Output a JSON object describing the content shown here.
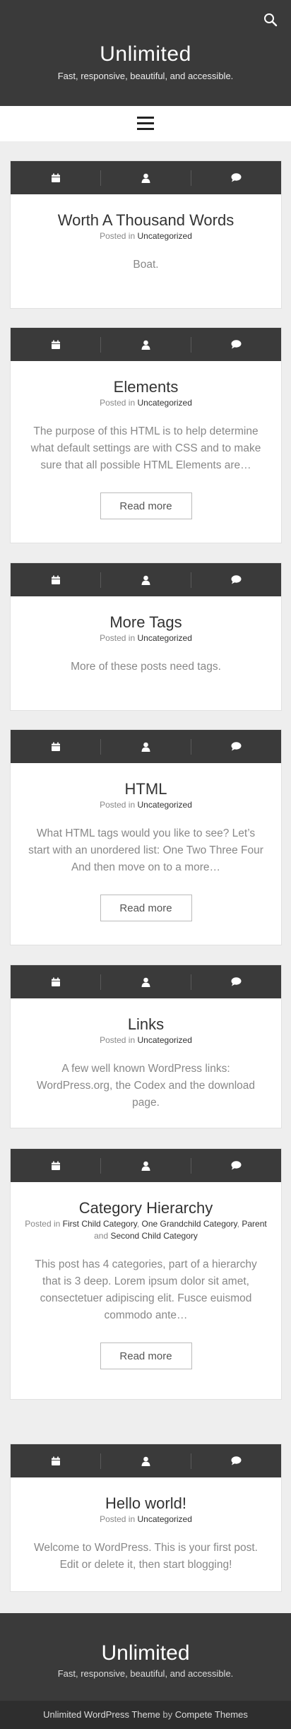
{
  "header": {
    "title": "Unlimited",
    "tagline": "Fast, responsive, beautiful, and accessible."
  },
  "posts": [
    {
      "title": "Worth A Thousand Words",
      "posted_in": "Posted in",
      "categories": [
        "Uncategorized"
      ],
      "excerpt": "Boat.",
      "read_more": ""
    },
    {
      "title": "Elements",
      "posted_in": "Posted in",
      "categories": [
        "Uncategorized"
      ],
      "excerpt": "The purpose of this HTML is to help determine what default settings are with CSS and to make sure that all possible HTML Elements are…",
      "read_more": "Read more"
    },
    {
      "title": "More Tags",
      "posted_in": "Posted in",
      "categories": [
        "Uncategorized"
      ],
      "excerpt": "More of these posts need tags.",
      "read_more": ""
    },
    {
      "title": "HTML",
      "posted_in": "Posted in",
      "categories": [
        "Uncategorized"
      ],
      "excerpt": "What HTML tags would you like to see? Let’s start with an unordered list: One Two Three Four And then move on to a more…",
      "read_more": "Read more"
    },
    {
      "title": "Links",
      "posted_in": "Posted in",
      "categories": [
        "Uncategorized"
      ],
      "excerpt": "A few well known WordPress links: WordPress.org, the Codex and the download page.",
      "read_more": ""
    },
    {
      "title": "Category Hierarchy",
      "posted_in": "Posted in",
      "categories": [
        "First Child Category",
        "One Grandchild Category",
        "Parent",
        "Second Child Category"
      ],
      "excerpt": "This post has 4 categories, part of a hierarchy that is 3 deep. Lorem ipsum dolor sit amet, consectetuer adipiscing elit. Fusce euismod commodo ante…",
      "read_more": "Read more"
    },
    {
      "title": "Hello world!",
      "posted_in": "Posted in",
      "categories": [
        "Uncategorized"
      ],
      "excerpt": "Welcome to WordPress. This is your first post. Edit or delete it, then start blogging!",
      "read_more": ""
    }
  ],
  "footer": {
    "title": "Unlimited",
    "tagline": "Fast, responsive, beautiful, and accessible.",
    "credit_link": "Unlimited WordPress Theme",
    "credit_by": "by",
    "credit_author": "Compete Themes"
  }
}
